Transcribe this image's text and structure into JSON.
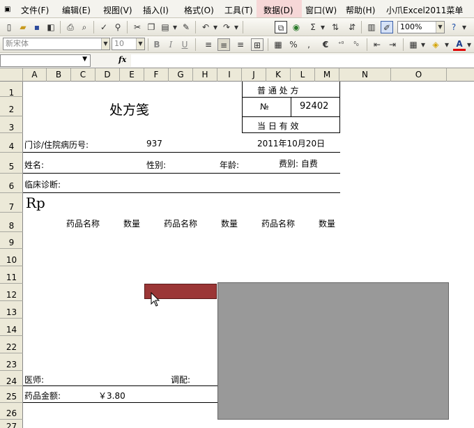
{
  "menu": {
    "items": [
      "文件(F)",
      "编辑(E)",
      "视图(V)",
      "插入(I)",
      "格式(O)",
      "工具(T)",
      "数据(D)",
      "窗口(W)",
      "帮助(H)",
      "小爪Excel2011菜单"
    ]
  },
  "toolbar": {
    "zoom": "100%",
    "font_name": "新宋体",
    "font_size": "10",
    "bold": "B",
    "italic": "I",
    "underline": "U",
    "percent": "%",
    "comma": ",",
    "euro": "€",
    "font_color": "A"
  },
  "formula_bar": {
    "fx": "fx",
    "name_box": "",
    "content": ""
  },
  "columns": [
    "A",
    "B",
    "C",
    "D",
    "E",
    "F",
    "G",
    "H",
    "I",
    "J",
    "K",
    "L",
    "M",
    "N",
    "O"
  ],
  "rows": [
    "1",
    "2",
    "3",
    "4",
    "5",
    "6",
    "7",
    "8",
    "9",
    "10",
    "11",
    "12",
    "13",
    "14",
    "22",
    "23",
    "24",
    "25",
    "26",
    "27"
  ],
  "sheet": {
    "title": "处方笺",
    "box_row1": "普  通  处  方",
    "box_no_label": "№",
    "box_no_value": "92402",
    "box_row3": "当  日  有  效",
    "record_label": "门诊/住院病历号:",
    "record_value": "937",
    "date": "2011年10月20日",
    "name_label": "姓名:",
    "gender_label": "性别:",
    "age_label": "年龄:",
    "fee_label": "费别: 自费",
    "diagnosis_label": "临床诊断:",
    "rp": "Rp",
    "drug_header_1": "药品名称",
    "qty_header_1": "数量",
    "drug_header_2": "药品名称",
    "qty_header_2": "数量",
    "drug_header_3": "药品名称",
    "qty_header_3": "数量",
    "doctor_label": "医师:",
    "dispense_label": "调配:",
    "amount_label": "药品金额:",
    "amount_value": "￥3.80"
  }
}
